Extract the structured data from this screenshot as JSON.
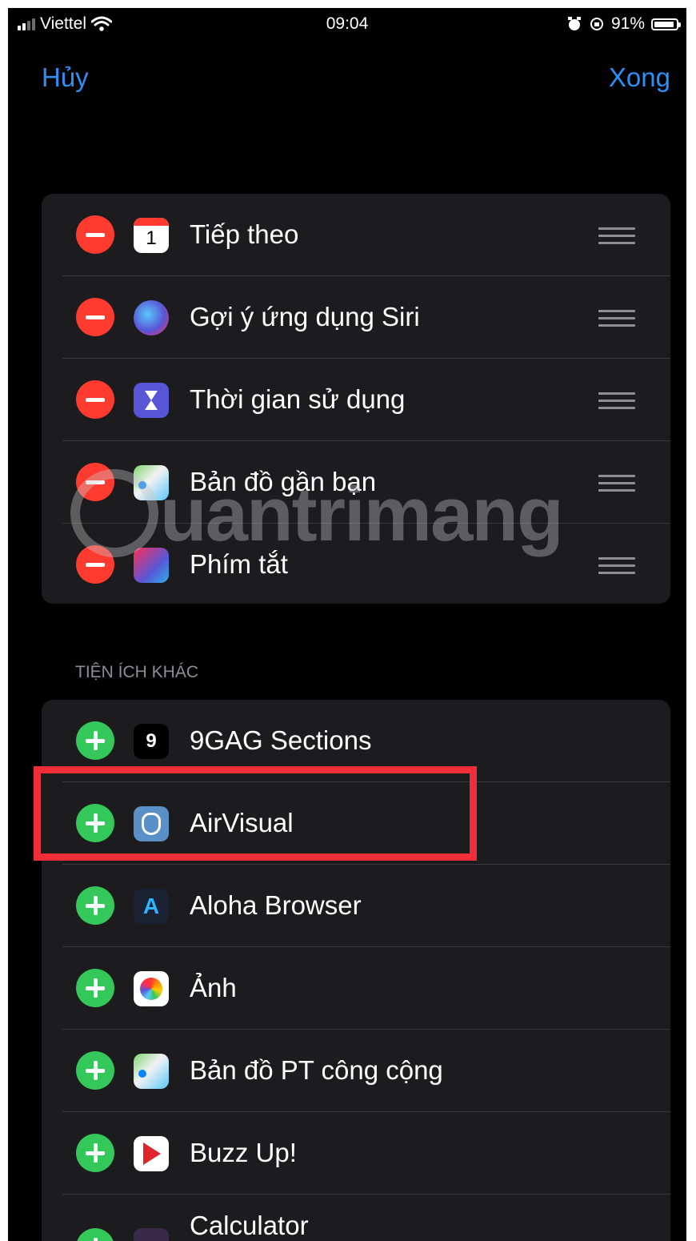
{
  "status": {
    "carrier": "Viettel",
    "time": "09:04",
    "battery_pct": "91%",
    "battery_level": 0.91
  },
  "nav": {
    "cancel": "Hủy",
    "done": "Xong"
  },
  "active_widgets": [
    {
      "label": "Tiếp theo",
      "icon": "calendar-icon"
    },
    {
      "label": "Gợi ý ứng dụng Siri",
      "icon": "siri-icon"
    },
    {
      "label": "Thời gian sử dụng",
      "icon": "hourglass-icon"
    },
    {
      "label": "Bản đồ gần bạn",
      "icon": "maps-icon"
    },
    {
      "label": "Phím tắt",
      "icon": "shortcuts-icon"
    }
  ],
  "section_header": "TIỆN ÍCH KHÁC",
  "other_widgets": [
    {
      "label": "9GAG Sections",
      "icon": "9gag-icon"
    },
    {
      "label": "AirVisual",
      "icon": "airvisual-icon"
    },
    {
      "label": "Aloha Browser",
      "icon": "aloha-icon"
    },
    {
      "label": "Ảnh",
      "icon": "photos-icon"
    },
    {
      "label": "Bản đồ PT công cộng",
      "icon": "maps-icon"
    },
    {
      "label": "Buzz Up!",
      "icon": "buzzup-icon"
    },
    {
      "label": "Calculator",
      "icon": "calculator-icon"
    }
  ],
  "watermark": "uantrimang",
  "colors": {
    "accent": "#2f8ef5",
    "remove": "#ff3b30",
    "add": "#34c759",
    "highlight": "#ef2e3a",
    "cell": "#1c1c1e"
  }
}
